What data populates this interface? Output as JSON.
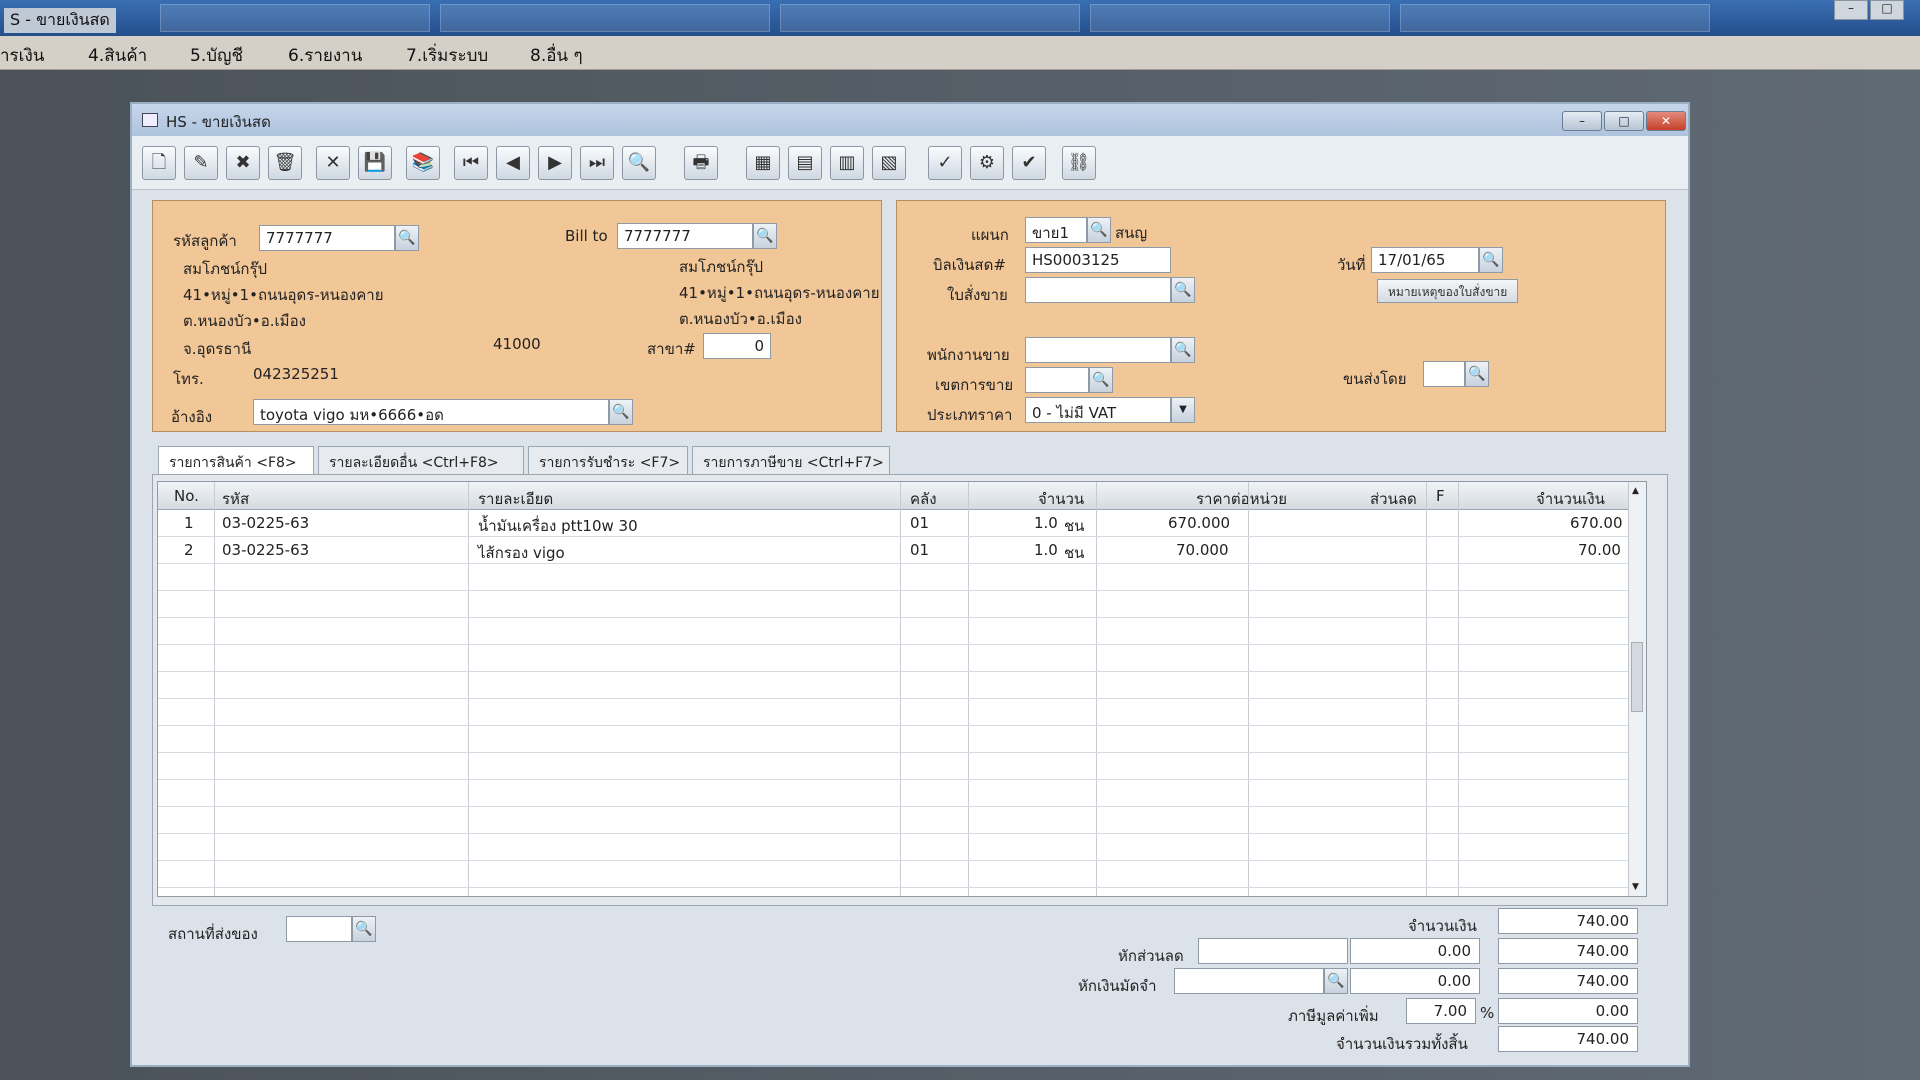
{
  "top": {
    "title": "S - ขายเงินสด"
  },
  "menu": [
    {
      "label": "ารเงิน"
    },
    {
      "label": "4.สินค้า"
    },
    {
      "label": "5.บัญชี"
    },
    {
      "label": "6.รายงาน"
    },
    {
      "label": "7.เริ่มระบบ"
    },
    {
      "label": "8.อื่น ๆ"
    }
  ],
  "window": {
    "title": "HS - ขายเงินสด",
    "min": "–",
    "max": "□",
    "close": "✕"
  },
  "toolbar": [
    {
      "icon": "new-doc-icon",
      "glyph": "🗋"
    },
    {
      "icon": "edit-icon",
      "glyph": "✎"
    },
    {
      "icon": "void-icon",
      "glyph": "✖"
    },
    {
      "icon": "trash-icon",
      "glyph": "🗑"
    },
    {
      "icon": "cancel-icon",
      "glyph": "✕"
    },
    {
      "icon": "save-icon",
      "glyph": "💾"
    },
    {
      "icon": "books-icon",
      "glyph": "📚"
    },
    {
      "icon": "first-icon",
      "glyph": "⏮"
    },
    {
      "icon": "prev-icon",
      "glyph": "◀"
    },
    {
      "icon": "next-icon",
      "glyph": "▶"
    },
    {
      "icon": "last-icon",
      "glyph": "⏭"
    },
    {
      "icon": "find-icon",
      "glyph": "🔍"
    },
    {
      "icon": "print-icon",
      "glyph": "🖶"
    },
    {
      "icon": "calc-icon",
      "glyph": "▦"
    },
    {
      "icon": "card-icon",
      "glyph": "▤"
    },
    {
      "icon": "chart-icon",
      "glyph": "▥"
    },
    {
      "icon": "report-icon",
      "glyph": "▧"
    },
    {
      "icon": "approve-icon",
      "glyph": "✓"
    },
    {
      "icon": "tools-icon",
      "glyph": "⚙"
    },
    {
      "icon": "ok-icon",
      "glyph": "✔"
    },
    {
      "icon": "network-icon",
      "glyph": "⛓"
    }
  ],
  "customer": {
    "code_label": "รหัสลูกค้า",
    "code": "7777777",
    "name": "สมโภชน์กรุ๊ป",
    "addr1": "41•หมู่•1•ถนนอุดร-หนองคาย",
    "addr2": "ต.หนองบัว•อ.เมือง",
    "addr3": "จ.อุดรธานี",
    "zip": "41000",
    "phone_label": "โทร.",
    "phone": "042325251",
    "ref_label": "อ้างอิง",
    "ref": "toyota vigo มห•6666•อด",
    "billto_label": "Bill to",
    "billto": "7777777",
    "bill_name": "สมโภชน์กรุ๊ป",
    "bill_addr1": "41•หมู่•1•ถนนอุดร-หนองคาย",
    "bill_addr2": "ต.หนองบัว•อ.เมือง",
    "branch_label": "สาขา#",
    "branch": "0"
  },
  "doc": {
    "dept_label": "แผนก",
    "dept": "ขาย1",
    "dept_name": "สนญ",
    "bill_label": "บิลเงินสด#",
    "bill_no": "HS0003125",
    "order_label": "ใบสั่งขาย",
    "date_label": "วันที่",
    "date": "17/01/65",
    "note_btn": "หมายเหตุของใบสั่งขาย",
    "sales_label": "พนักงานขาย",
    "area_label": "เขตการขาย",
    "ship_label": "ขนส่งโดย",
    "price_label": "ประเภทราคา",
    "price_type": "0 - ไม่มี VAT"
  },
  "tabs": [
    {
      "label": "รายการสินค้า <F8>"
    },
    {
      "label": "รายละเอียดอื่น <Ctrl+F8>"
    },
    {
      "label": "รายการรับชำระ <F7>"
    },
    {
      "label": "รายการภาษีขาย <Ctrl+F7>"
    }
  ],
  "grid": {
    "headers": {
      "no": "No.",
      "code": "รหัส",
      "desc": "รายละเอียด",
      "wh": "คลัง",
      "qty": "จำนวน",
      "price": "ราคาต่อหน่วย",
      "disc": "ส่วนลด",
      "f": "F",
      "amount": "จำนวนเงิน"
    },
    "rows": [
      {
        "no": "1",
        "code": "03-0225-63",
        "desc": "น้ำมันเครื่อง ptt10w 30",
        "wh": "01",
        "qty": "1.0",
        "unit": "ชน",
        "price": "670.000",
        "amount": "670.00"
      },
      {
        "no": "2",
        "code": "03-0225-63",
        "desc": "ไส้กรอง vigo",
        "wh": "01",
        "qty": "1.0",
        "unit": "ชน",
        "price": "70.000",
        "amount": "70.00"
      }
    ]
  },
  "footer": {
    "ship_place_label": "สถานที่ส่งของ",
    "amount_label": "จำนวนเงิน",
    "amount": "740.00",
    "discount_label": "หักส่วนลด",
    "discount": "0.00",
    "after_discount": "740.00",
    "deposit_label": "หักเงินมัดจำ",
    "deposit": "0.00",
    "after_deposit": "740.00",
    "vat_label": "ภาษีมูลค่าเพิ่ม",
    "vat_rate": "7.00",
    "vat_pct": "%",
    "vat": "0.00",
    "total_label": "จำนวนเงินรวมทั้งสิ้น",
    "total": "740.00"
  }
}
